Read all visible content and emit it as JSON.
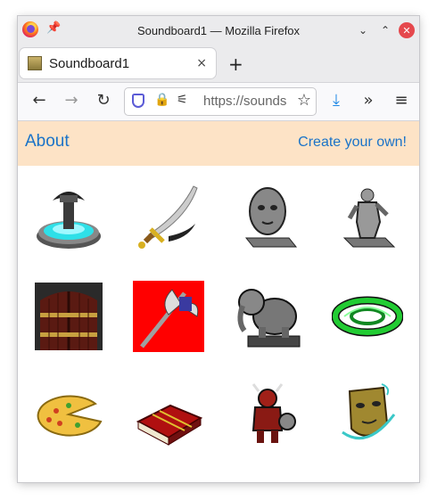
{
  "window": {
    "title": "Soundboard1 — Mozilla Firefox",
    "pin_icon": "pin-icon",
    "minimize_icon": "chevron-down-icon",
    "maximize_icon": "chevron-up-icon",
    "close_icon": "close-icon"
  },
  "tab": {
    "label": "Soundboard1",
    "close_glyph": "×",
    "new_tab_glyph": "+"
  },
  "nav": {
    "back": "←",
    "forward": "→",
    "reload": "↻",
    "url": "https://sounds",
    "download": "⤓",
    "more": "»",
    "menu": "≡"
  },
  "page": {
    "about_label": "About",
    "create_label": "Create your own!",
    "header_bg": "#fde3c6",
    "link_color": "#1a73c8"
  },
  "sounds": [
    {
      "icon": "fountain-icon"
    },
    {
      "icon": "scimitar-icon"
    },
    {
      "icon": "stone-head-statue-icon"
    },
    {
      "icon": "warrior-statue-icon"
    },
    {
      "icon": "wooden-door-icon"
    },
    {
      "icon": "battle-axe-icon"
    },
    {
      "icon": "elephant-statue-icon"
    },
    {
      "icon": "green-portal-ring-icon"
    },
    {
      "icon": "pizza-icon"
    },
    {
      "icon": "red-spellbook-icon"
    },
    {
      "icon": "demon-warrior-icon"
    },
    {
      "icon": "golden-mask-icon"
    }
  ]
}
